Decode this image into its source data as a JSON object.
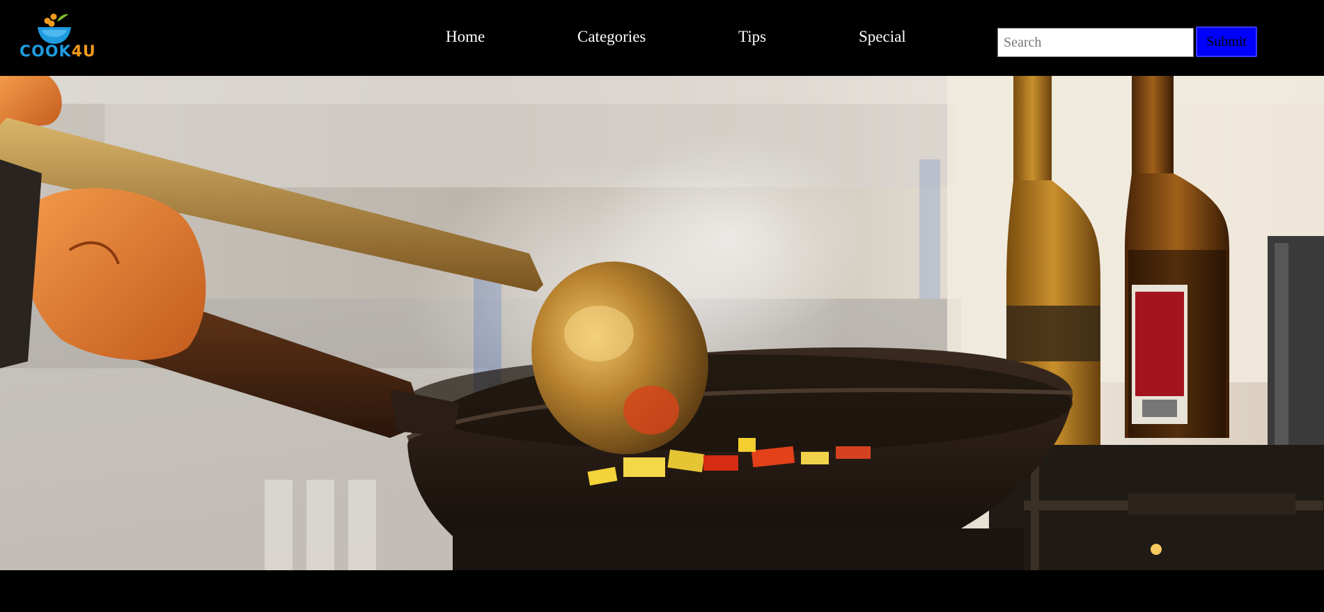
{
  "brand": {
    "name_part1": "COOK",
    "name_part2": "4U",
    "color_primary": "#1f9be0",
    "color_accent": "#f29a1e"
  },
  "nav": {
    "links": [
      {
        "label": "Home"
      },
      {
        "label": "Categories"
      },
      {
        "label": "Tips"
      },
      {
        "label": "Special"
      }
    ]
  },
  "search": {
    "placeholder": "Search",
    "value": "",
    "submit_label": "Submit",
    "submit_color": "#0000ff"
  },
  "hero": {
    "icon": "wok-cooking-photo"
  }
}
